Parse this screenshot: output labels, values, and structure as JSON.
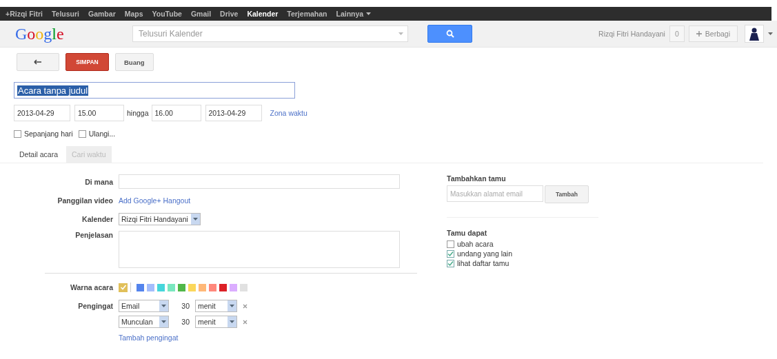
{
  "top_nav": {
    "items": [
      {
        "label": "+Rizqi Fitri",
        "selected": false
      },
      {
        "label": "Telusuri",
        "selected": false
      },
      {
        "label": "Gambar",
        "selected": false
      },
      {
        "label": "Maps",
        "selected": false
      },
      {
        "label": "YouTube",
        "selected": false
      },
      {
        "label": "Gmail",
        "selected": false
      },
      {
        "label": "Drive",
        "selected": false
      },
      {
        "label": "Kalender",
        "selected": true
      },
      {
        "label": "Terjemahan",
        "selected": false
      }
    ],
    "more": "Lainnya"
  },
  "header": {
    "logo": "Google",
    "search": {
      "placeholder": "Telusuri Kalender"
    },
    "user": "Rizqi Fitri Handayani",
    "count": "0",
    "share": "Berbagi"
  },
  "toolbar": {
    "save": "SIMPAN",
    "discard": "Buang"
  },
  "event": {
    "title": "Acara tanpa judul",
    "start_date": "2013-04-29",
    "start_time": "15.00",
    "until": "hingga",
    "end_time": "16.00",
    "end_date": "2013-04-29",
    "timezone": "Zona waktu"
  },
  "options": [
    {
      "label": "Sepanjang hari",
      "checked": false
    },
    {
      "label": "Ulangi...",
      "checked": false
    }
  ],
  "tabs": [
    {
      "label": "Detail acara",
      "selected": true
    },
    {
      "label": "Cari waktu",
      "selected": false
    }
  ],
  "details": {
    "where_label": "Di mana",
    "video_label": "Panggilan video",
    "video_link": "Add Google+ Hangout",
    "calendar_label": "Kalender",
    "calendar_value": "Rizqi Fitri Handayani",
    "description_label": "Penjelasan"
  },
  "colors": {
    "label": "Warna acara",
    "default": {
      "color": "#e1c05a",
      "selected": true
    },
    "swatches": [
      {
        "color": "#5484ed",
        "selected": false
      },
      {
        "color": "#a4bdfc",
        "selected": false
      },
      {
        "color": "#46d6db",
        "selected": false
      },
      {
        "color": "#7ae7bf",
        "selected": false
      },
      {
        "color": "#51b749",
        "selected": false
      },
      {
        "color": "#fbd75b",
        "selected": false
      },
      {
        "color": "#ffb878",
        "selected": false
      },
      {
        "color": "#ff887c",
        "selected": false
      },
      {
        "color": "#dc2127",
        "selected": false
      },
      {
        "color": "#dbadff",
        "selected": false
      },
      {
        "color": "#e1e1e1",
        "selected": false
      }
    ]
  },
  "reminders": {
    "label": "Pengingat",
    "items": [
      {
        "method": "Email",
        "amount": "30",
        "unit": "menit"
      },
      {
        "method": "Munculan",
        "amount": "30",
        "unit": "menit"
      }
    ],
    "add": "Tambah pengingat"
  },
  "guests": {
    "title": "Tambahkan tamu",
    "placeholder": "Masukkan alamat email",
    "add": "Tambah",
    "can_title": "Tamu dapat",
    "permissions": [
      {
        "label": "ubah acara",
        "checked": false
      },
      {
        "label": "undang yang lain",
        "checked": true
      },
      {
        "label": "lihat daftar tamu",
        "checked": true
      }
    ]
  }
}
